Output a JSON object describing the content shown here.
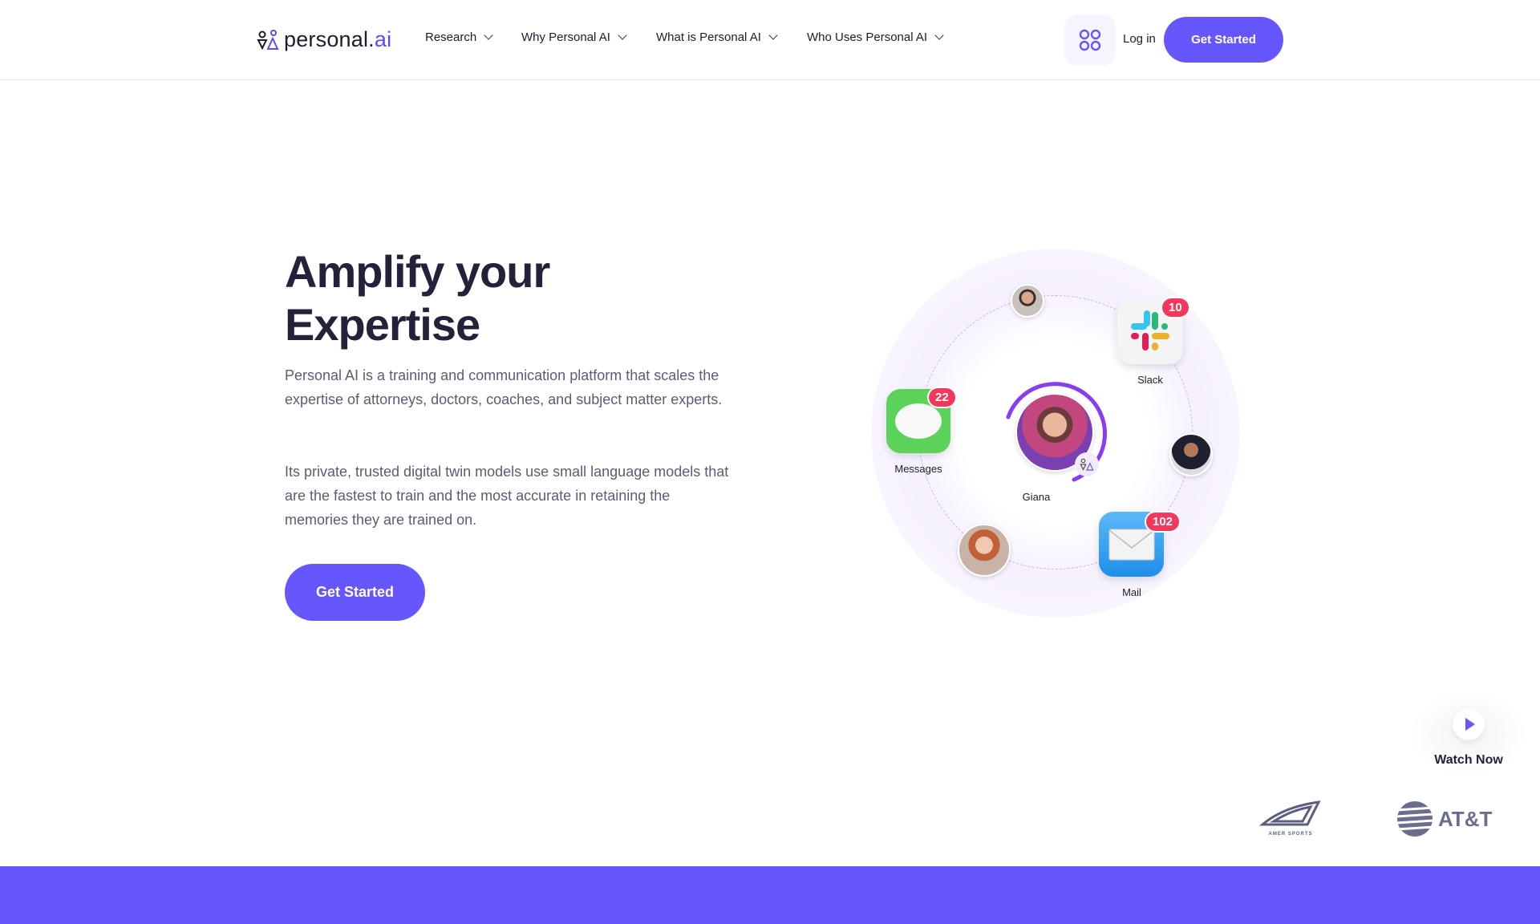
{
  "header": {
    "logo": {
      "text_main": "personal.",
      "text_ai": "ai",
      "text_dot": "."
    },
    "nav": [
      {
        "label": "Research"
      },
      {
        "label": "Why Personal AI"
      },
      {
        "label": "What is Personal AI"
      },
      {
        "label": "Who Uses Personal AI"
      }
    ],
    "apps_icon": "grid-icon",
    "login_label": "Log in",
    "cta_label": "Get Started"
  },
  "hero": {
    "title_line1": "Amplify your",
    "title_line2": "Expertise",
    "paragraph1": "Personal AI is a training and communication platform that scales the expertise of attorneys, doctors, coaches, and subject matter experts.",
    "paragraph2": "Its private, trusted digital twin models use small language models that are the fastest to train and the most accurate in retaining the memories they are trained on.",
    "cta_label": "Get Started"
  },
  "diagram": {
    "center_name": "Giana",
    "apps": [
      {
        "name": "Messages",
        "badge": "22",
        "color": "#5bd35a"
      },
      {
        "name": "Slack",
        "badge": "10",
        "color": "#f4f4f4"
      },
      {
        "name": "Mail",
        "badge": "102",
        "color": "#2f9ff0"
      }
    ]
  },
  "watch": {
    "label": "Watch Now",
    "icon": "play-icon"
  },
  "logos": {
    "amer": "AMER SPORTS",
    "att": "AT&T"
  },
  "colors": {
    "accent": "#6657fd",
    "badge": "#f2385d",
    "text": "#24223a"
  }
}
